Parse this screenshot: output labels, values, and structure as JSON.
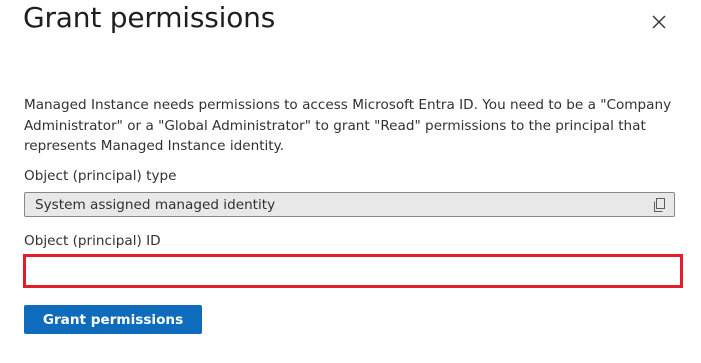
{
  "panel": {
    "title": "Grant permissions",
    "close_icon": "close-icon"
  },
  "description": "Managed Instance needs permissions to access Microsoft Entra ID. You need to be a \"Company Administrator\" or a \"Global Administrator\" to grant \"Read\" permissions to the principal that represents Managed Instance identity.",
  "fields": {
    "principal_type": {
      "label": "Object (principal) type",
      "value": "System assigned managed identity",
      "icon": "copy-icon"
    },
    "principal_id": {
      "label": "Object (principal) ID",
      "value": "",
      "highlight_color": "#e21e2b"
    }
  },
  "actions": {
    "grant_label": "Grant permissions",
    "grant_color": "#0f6cbd"
  }
}
